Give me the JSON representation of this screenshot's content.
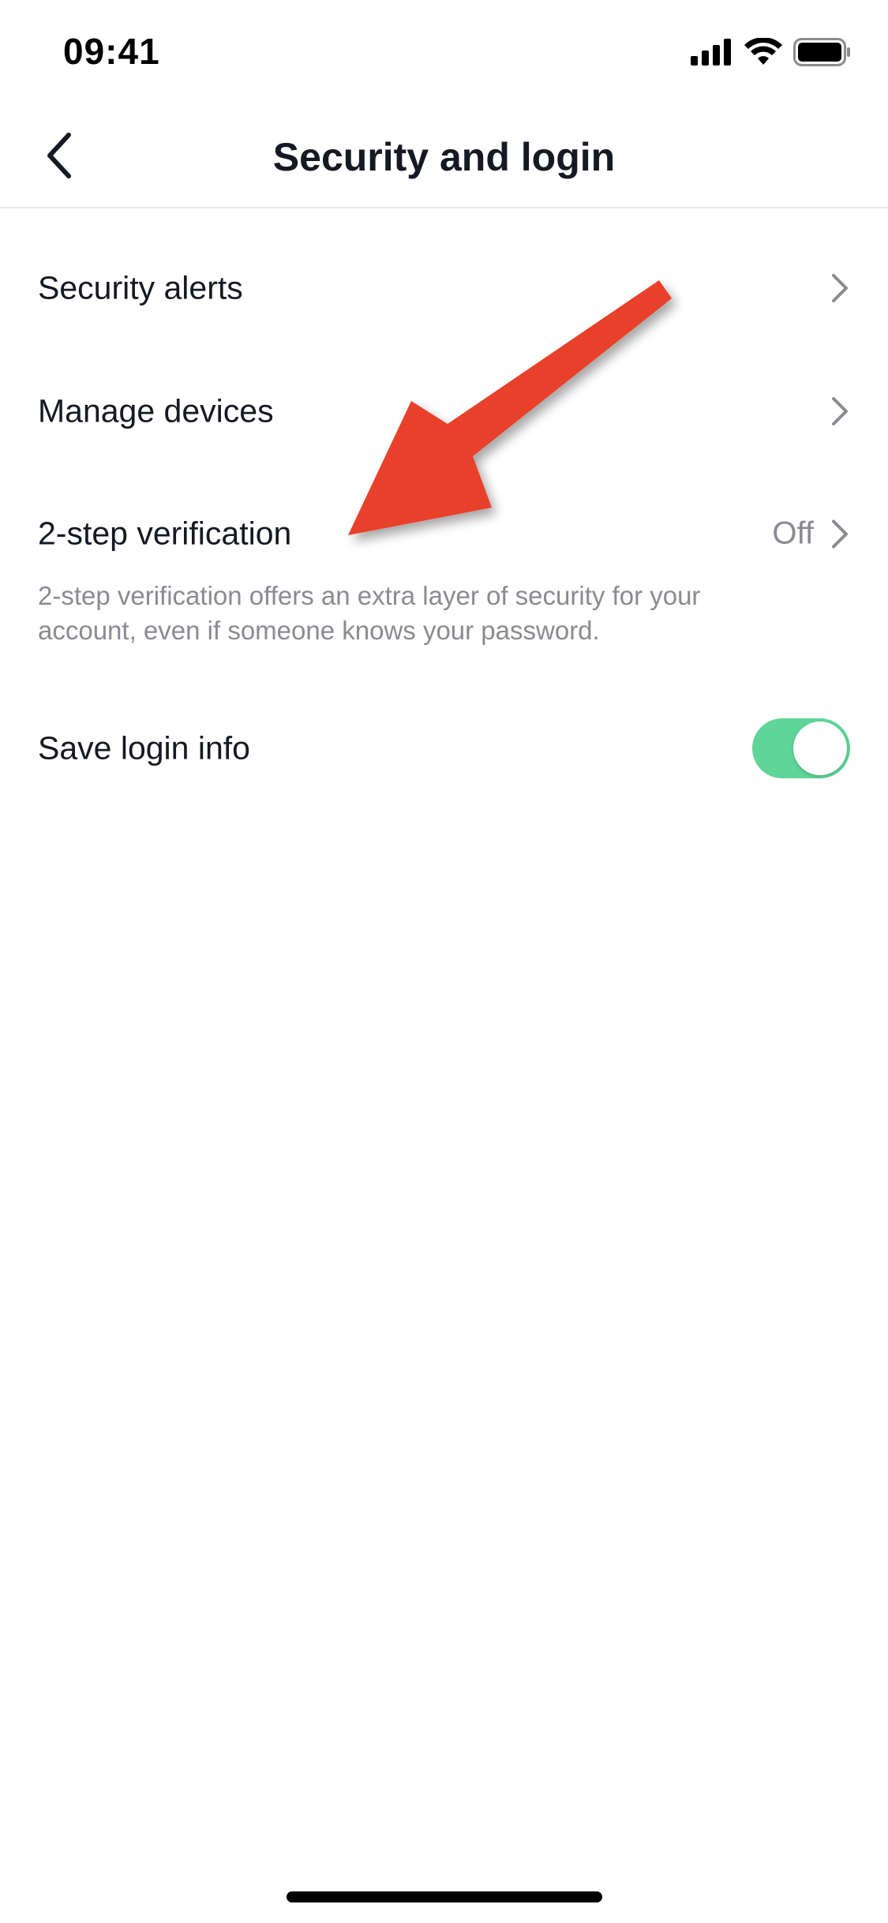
{
  "status_bar": {
    "time": "09:41"
  },
  "header": {
    "title": "Security and login",
    "back_icon": "chevron-left-icon"
  },
  "rows": [
    {
      "label": "Security alerts",
      "value": "",
      "icon": "chevron-right-icon"
    },
    {
      "label": "Manage devices",
      "value": "",
      "icon": "chevron-right-icon"
    },
    {
      "label": "2-step verification",
      "value": "Off",
      "icon": "chevron-right-icon"
    }
  ],
  "two_step_help": "2-step verification offers an extra layer of security for your account, even if someone knows your password.",
  "save_login": {
    "label": "Save login info",
    "enabled": true
  },
  "colors": {
    "toggle_on": "#5fd597",
    "annotation_arrow": "#e8402a",
    "secondary_text": "#8a8b91",
    "primary_text": "#161823"
  }
}
